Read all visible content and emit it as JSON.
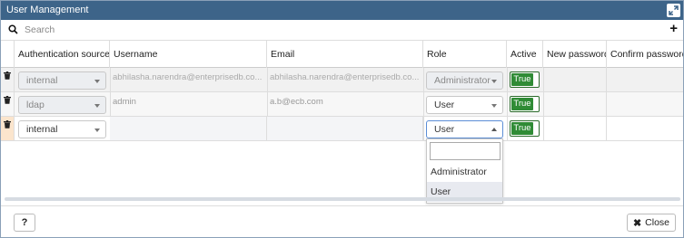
{
  "window": {
    "title": "User Management"
  },
  "search": {
    "placeholder": "Search"
  },
  "toolbar": {
    "add_label": "+"
  },
  "columns": [
    "Authentication source",
    "Username",
    "Email",
    "Role",
    "Active",
    "New password",
    "Confirm password"
  ],
  "rows": [
    {
      "auth_source": "internal",
      "username": "abhilasha.narendra@enterprisedb.co...",
      "email": "abhilasha.narendra@enterprisedb.co...",
      "role": "Administrator",
      "active": "True",
      "new_password": "",
      "confirm_password": ""
    },
    {
      "auth_source": "ldap",
      "username": "admin",
      "email": "a.b@ecb.com",
      "role": "User",
      "active": "True",
      "new_password": "",
      "confirm_password": ""
    },
    {
      "auth_source": "internal",
      "username": "",
      "email": "",
      "role": "User",
      "active": "True",
      "new_password": "",
      "confirm_password": ""
    }
  ],
  "role_dropdown": {
    "search_value": "",
    "options": [
      "Administrator",
      "User"
    ],
    "highlighted": "User"
  },
  "footer": {
    "help_label": "?",
    "close_label": "Close"
  },
  "colors": {
    "titlebar": "#3d6489",
    "active_toggle": "#2f8b35",
    "new_row_marker": "#fbe5cd"
  },
  "icons": [
    "search-icon",
    "plus-icon",
    "maximize-icon",
    "trash-icon",
    "close-icon",
    "help-icon"
  ]
}
